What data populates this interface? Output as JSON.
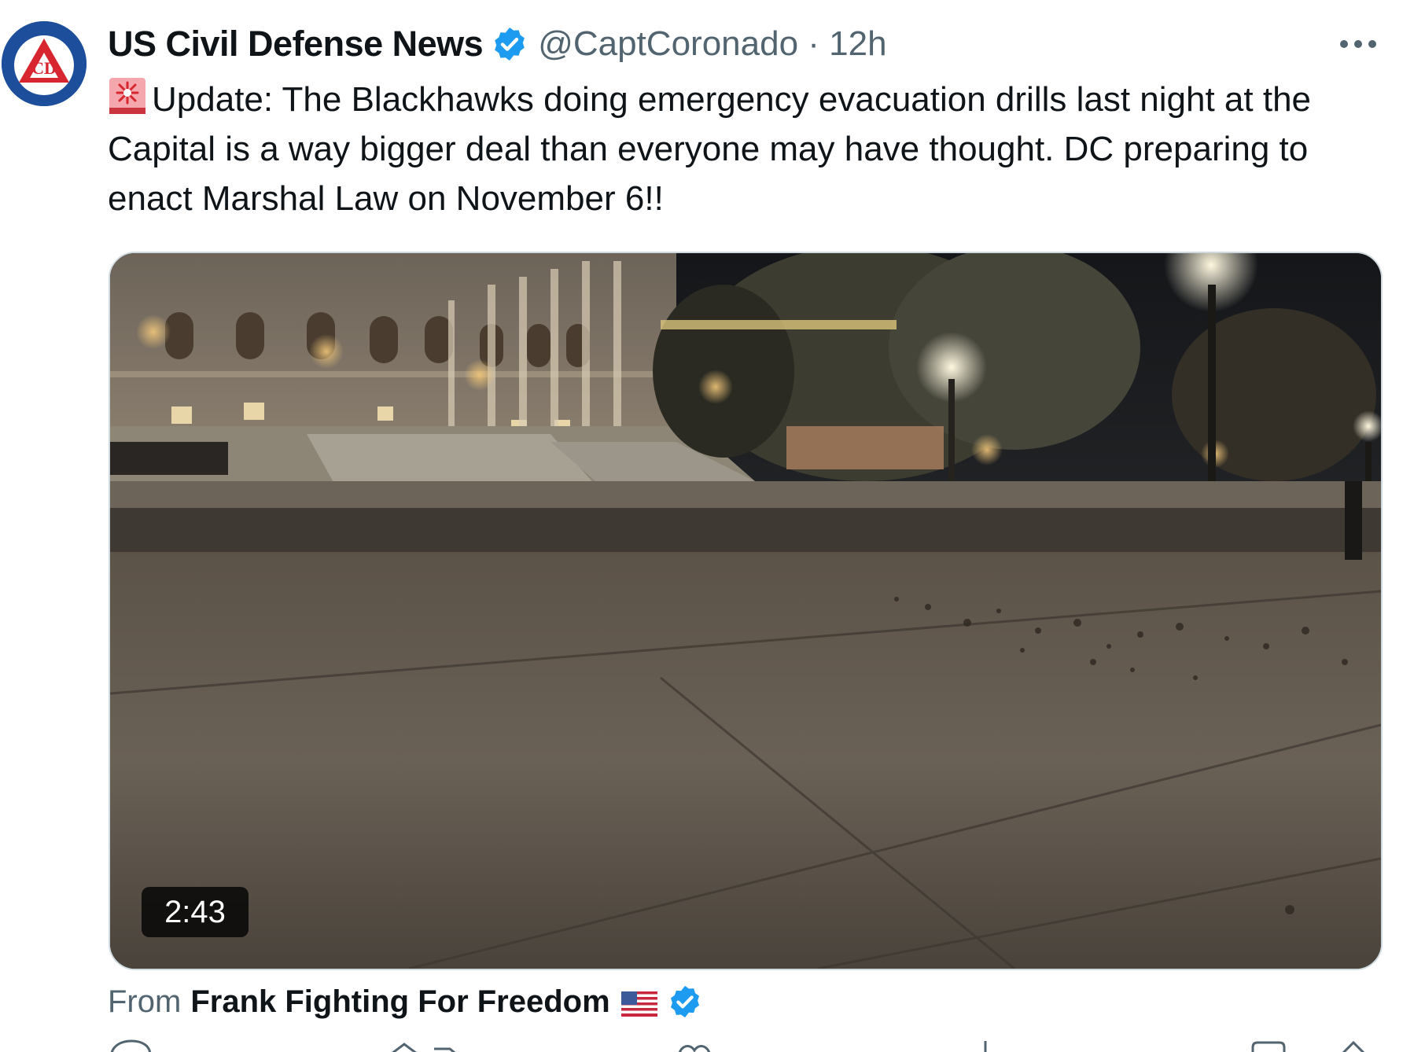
{
  "tweet": {
    "display_name": "US Civil Defense News",
    "handle": "@CaptCoronado",
    "separator": " · ",
    "time": "12h",
    "text": "Update: The Blackhawks doing emergency evacuation drills last night at the Capital is a way bigger deal than everyone may have thought. DC preparing to enact Marshal Law on November 6!!",
    "icons": {
      "avatar": "civil-defense-logo",
      "verified": "verified-badge-icon",
      "more": "more-options-icon",
      "emoji": "siren-icon"
    }
  },
  "media": {
    "type": "video",
    "duration": "2:43",
    "description_icon": "video-thumbnail"
  },
  "source": {
    "from_label": "From",
    "name": "Frank Fighting For Freedom",
    "flag_icon": "us-flag-icon",
    "verified_icon": "verified-badge-icon"
  },
  "actions": {
    "icons": [
      "reply-icon",
      "repost-icon",
      "like-icon",
      "views-icon",
      "bookmark-icon",
      "share-icon"
    ]
  },
  "colors": {
    "brand_blue": "#1d9bf0",
    "text": "#0f1419",
    "secondary": "#536471",
    "avatar_blue": "#1d4e9c"
  }
}
